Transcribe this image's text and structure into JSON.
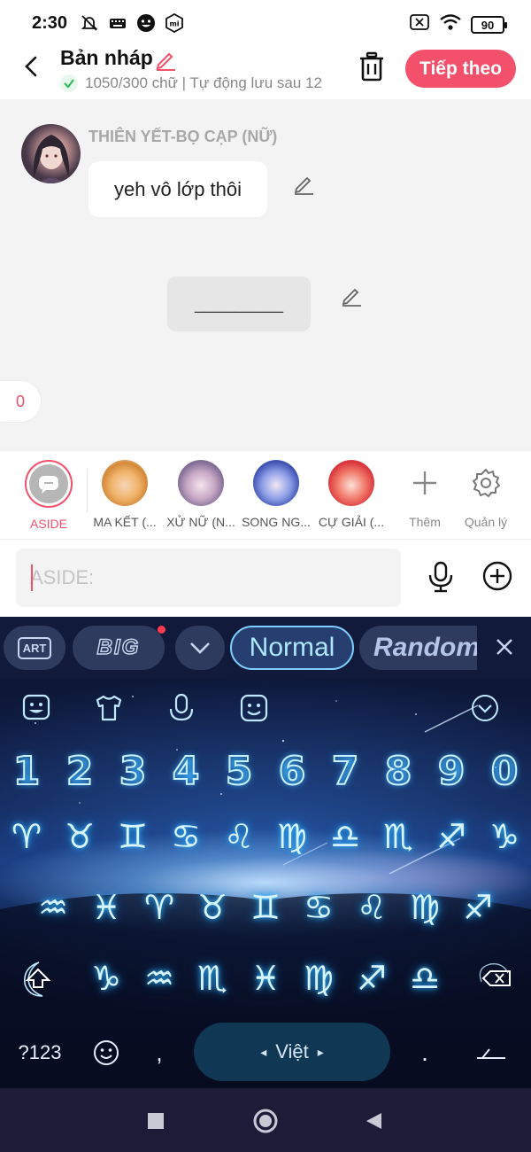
{
  "status_bar": {
    "time": "2:30",
    "battery": "90",
    "icons": [
      "notifications-off-icon",
      "keyboard-icon",
      "emoji-app-icon",
      "mi-icon",
      "sim-off-icon",
      "wifi-icon",
      "battery-icon"
    ]
  },
  "header": {
    "title": "Bản nháp",
    "subtitle": "1050/300 chữ | Tự động lưu sau 12",
    "next_label": "Tiếp theo"
  },
  "chat": {
    "speaker": "THIÊN YẾT-BỌ CẠP (NỮ)",
    "message": "yeh vô lớp thôi",
    "aside_text": "_________",
    "counter": "0"
  },
  "characters": [
    {
      "label": "ASIDE",
      "selected": true
    },
    {
      "label": "MA KẾT (..."
    },
    {
      "label": "XỬ NỮ (N..."
    },
    {
      "label": "SONG NG..."
    },
    {
      "label": "CỰ GIẢI (..."
    },
    {
      "label": "Thêm"
    },
    {
      "label": "Quản lý"
    }
  ],
  "input": {
    "placeholder": "ASIDE:"
  },
  "keyboard": {
    "toolbar": {
      "art_label": "ART",
      "big_label": "BIG",
      "normal_label": "Normal",
      "random_label": "Random"
    },
    "numbers": [
      "1",
      "2",
      "3",
      "4",
      "5",
      "6",
      "7",
      "8",
      "9",
      "0"
    ],
    "zodiac_row1": [
      "♈",
      "♉",
      "♊",
      "♋",
      "♌",
      "♍",
      "♎",
      "♏",
      "♐",
      "♑"
    ],
    "zodiac_row2": [
      "♒",
      "♓",
      "♈",
      "♉",
      "♊",
      "♋",
      "♌",
      "♍",
      "♐"
    ],
    "zodiac_row3": [
      "♑",
      "♒",
      "♏",
      "♓",
      "♍",
      "♐",
      "♎"
    ],
    "symbols_key": "?123",
    "comma": ",",
    "space_label": "Việt",
    "period": "."
  },
  "colors": {
    "accent": "#f2506b",
    "chat_bg": "#f3f3f3",
    "nav_bg": "#1c1b38"
  }
}
